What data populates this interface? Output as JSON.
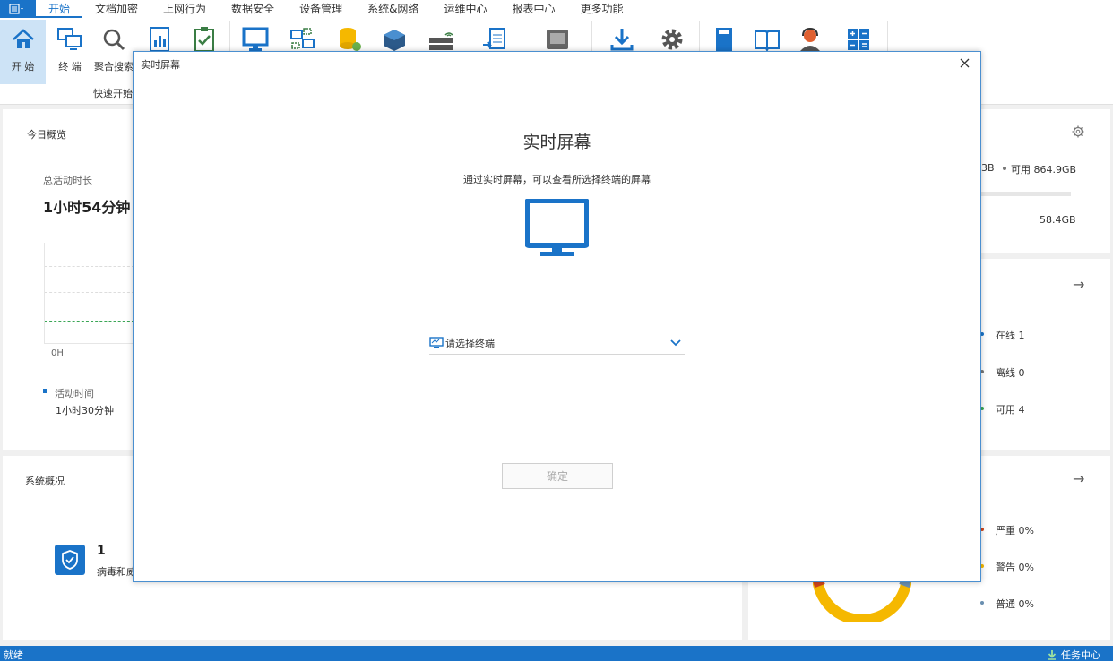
{
  "menubar": {
    "items": [
      "开始",
      "文档加密",
      "上网行为",
      "数据安全",
      "设备管理",
      "系统&网络",
      "运维中心",
      "报表中心",
      "更多功能"
    ],
    "active": "开始"
  },
  "ribbon": {
    "home_label": "开 始",
    "terminal_label": "终 端",
    "search_label": "聚合搜索",
    "group_label": "快速开始",
    "icons": [
      "home-icon",
      "terminal-icon",
      "search-icon",
      "report-icon",
      "checklist-icon",
      "monitor-icon",
      "network-icon",
      "database-icon",
      "package-icon",
      "server-icon",
      "document-transfer-icon",
      "device-icon",
      "download-icon",
      "gear-icon",
      "manual-icon",
      "book-icon",
      "support-icon",
      "calculator-icon"
    ]
  },
  "today": {
    "title": "今日概览",
    "total_label": "总活动时长",
    "total_value": "1小时54分钟",
    "axis_label": "0H",
    "legend_label": "活动时间",
    "legend_value": "1小时30分钟"
  },
  "system": {
    "title": "系统概况",
    "threat_count": "1",
    "threat_label": "病毒和威"
  },
  "disk": {
    "used_suffix": "3B",
    "available_label": "可用 864.9GB",
    "other_value": "58.4GB"
  },
  "terminals": {
    "online": "在线  1",
    "offline": "离线  0",
    "available": "可用  4"
  },
  "alerts": {
    "severe": "严重  0%",
    "warning": "警告  0%",
    "normal": "普通  0%"
  },
  "dialog": {
    "title": "实时屏幕",
    "heading": "实时屏幕",
    "description": "通过实时屏幕，可以查看所选择终端的屏幕",
    "select_placeholder": "请选择终端",
    "confirm_label": "确定"
  },
  "statusbar": {
    "left": "就绪",
    "task_center": "任务中心"
  },
  "colors": {
    "accent": "#1a73c8",
    "dialog_border": "#4a8fd0"
  }
}
